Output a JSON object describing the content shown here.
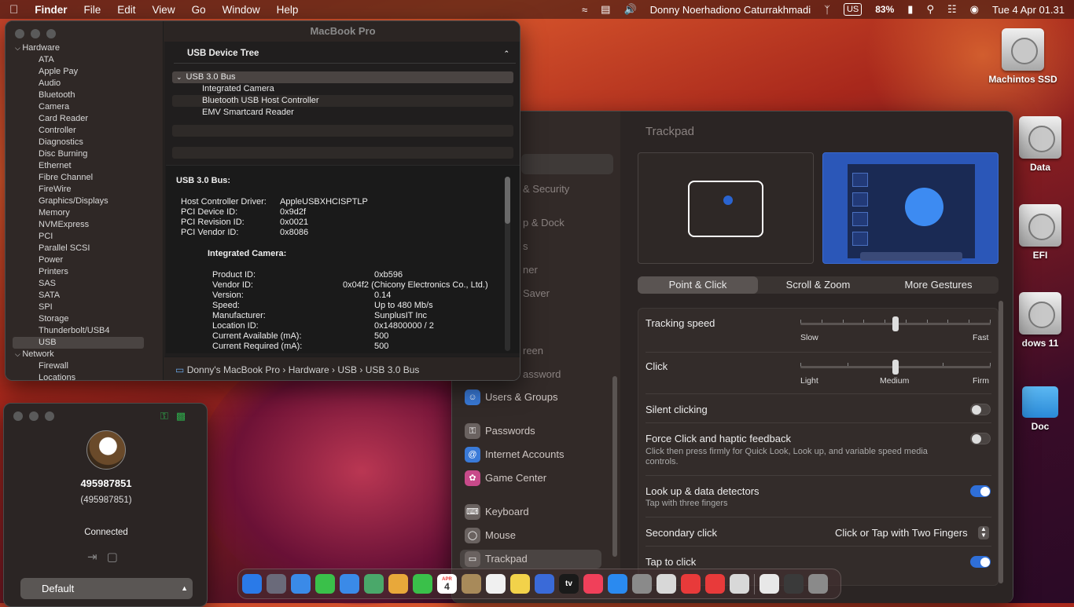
{
  "menubar": {
    "apple": "",
    "app": "Finder",
    "menus": [
      "File",
      "Edit",
      "View",
      "Go",
      "Window",
      "Help"
    ],
    "user": "Donny Noerhadiono Caturrakhmadi",
    "input_source": "US",
    "battery": "83%",
    "datetime": "Tue 4 Apr  01.31"
  },
  "sysinfo": {
    "title": "MacBook Pro",
    "sidebar": {
      "hardware": "Hardware",
      "items": [
        "ATA",
        "Apple Pay",
        "Audio",
        "Bluetooth",
        "Camera",
        "Card Reader",
        "Controller",
        "Diagnostics",
        "Disc Burning",
        "Ethernet",
        "Fibre Channel",
        "FireWire",
        "Graphics/Displays",
        "Memory",
        "NVMExpress",
        "PCI",
        "Parallel SCSI",
        "Power",
        "Printers",
        "SAS",
        "SATA",
        "SPI",
        "Storage",
        "Thunderbolt/USB4",
        "USB"
      ],
      "network": "Network",
      "network_items": [
        "Firewall",
        "Locations"
      ]
    },
    "tree_header": "USB Device Tree",
    "tree_bus": "USB 3.0 Bus",
    "tree_devices": [
      "Integrated Camera",
      "Bluetooth USB Host Controller",
      "EMV Smartcard Reader"
    ],
    "detail": {
      "heading": "USB 3.0 Bus:",
      "bus_keys": [
        "Host Controller Driver:",
        "PCI Device ID:",
        "PCI Revision ID:",
        "PCI Vendor ID:"
      ],
      "bus_vals": [
        "AppleUSBXHCISPTLP",
        "0x9d2f",
        "0x0021",
        "0x8086"
      ],
      "device_heading": "Integrated Camera:",
      "dev_keys": [
        "Product ID:",
        "Vendor ID:",
        "Version:",
        "Speed:",
        "Manufacturer:",
        "Location ID:",
        "Current Available (mA):",
        "Current Required (mA):"
      ],
      "dev_vals": [
        "0xb596",
        "0x04f2  (Chicony Electronics Co., Ltd.)",
        "0.14",
        "Up to 480 Mb/s",
        "SunplusIT Inc",
        "0x14800000 / 2",
        "500",
        "500"
      ]
    },
    "pathbar": "Donny's MacBook Pro  ›  Hardware  ›  USB  ›  USB 3.0 Bus"
  },
  "remote": {
    "id": "495987851",
    "id_paren": "(495987851)",
    "status": "Connected",
    "profile": "Default"
  },
  "settings": {
    "sidebar_fragments": [
      "& Security",
      "p & Dock",
      "s",
      "ner",
      "Saver",
      "reen",
      "assword"
    ],
    "sidebar_items": [
      "Users & Groups",
      "Passwords",
      "Internet Accounts",
      "Game Center",
      "Keyboard",
      "Mouse",
      "Trackpad"
    ],
    "title": "Trackpad",
    "tabs": [
      "Point & Click",
      "Scroll & Zoom",
      "More Gestures"
    ],
    "tracking_speed": {
      "label": "Tracking speed",
      "min": "Slow",
      "max": "Fast",
      "value": 0.5
    },
    "click": {
      "label": "Click",
      "left": "Light",
      "mid": "Medium",
      "right": "Firm",
      "value": 0.5
    },
    "silent_clicking": {
      "label": "Silent clicking",
      "on": false
    },
    "force_click": {
      "label": "Force Click and haptic feedback",
      "desc": "Click then press firmly for Quick Look, Look up, and variable speed media controls.",
      "on": false
    },
    "lookup": {
      "label": "Look up & data detectors",
      "desc": "Tap with three fingers",
      "on": true
    },
    "secondary_click": {
      "label": "Secondary click",
      "value": "Click or Tap with Two Fingers"
    },
    "tap_to_click": {
      "label": "Tap to click",
      "on": true
    }
  },
  "desktop": {
    "icons": [
      "Machintos SSD",
      "Data",
      "EFI",
      "dows 11",
      "Doc"
    ]
  },
  "dock": {
    "apps": [
      "finder-icon",
      "launchpad-icon",
      "safari-icon",
      "messages-icon",
      "mail-icon",
      "maps-icon",
      "photos-icon",
      "facetime-icon",
      "calendar-icon",
      "contacts-icon",
      "reminders-icon",
      "notes-icon",
      "freeform-icon",
      "tv-icon",
      "music-icon",
      "appstore-icon",
      "settings-icon",
      "preview-icon",
      "anydesk-icon",
      "anydesk2-icon",
      "printer-icon",
      "document-icon",
      "screen-icon",
      "trash-icon"
    ],
    "calendar_day": "4",
    "calendar_month": "APR",
    "tv_label": "tv"
  },
  "colors": {
    "accent": "#2f6fd8"
  }
}
